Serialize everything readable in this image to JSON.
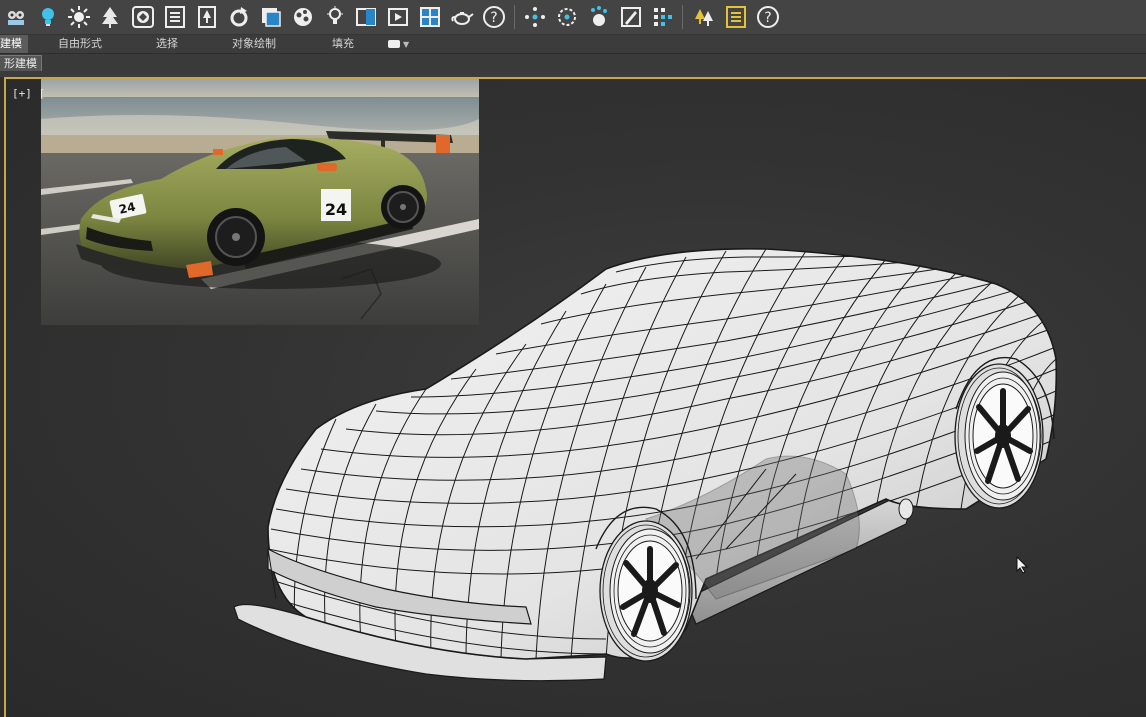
{
  "toolbar": {
    "groups": [
      [
        "render-setup-icon",
        "light-bulb-icon",
        "sun-icon",
        "tree-icon",
        "material-editor-icon",
        "list-icon",
        "figure-icon",
        "rotate-icon",
        "render-frame-icon",
        "shader-ball-icon",
        "bulb-small-icon",
        "render-region-icon",
        "render-view-icon",
        "viewport-icon",
        "teapot-icon",
        "help-icon"
      ],
      [
        "scatter-icon",
        "target-icon",
        "particles-icon",
        "paint-icon",
        "grid-select-icon"
      ],
      [
        "forest-icon",
        "layer-list-icon",
        "help-icon-2"
      ]
    ]
  },
  "ribbon": {
    "tabs": [
      "建模",
      "自由形式",
      "选择",
      "对象绘制",
      "填充"
    ],
    "active_index": 0,
    "extra_menu_icon": "display-dropdown-icon"
  },
  "subbar": {
    "label": "形建模"
  },
  "viewport": {
    "label": "[+] [",
    "reference_image": {
      "subject": "green race car with orange accents on a parking lot by the sea",
      "race_number": "24"
    },
    "colors": {
      "border_active": "#c8a64a",
      "car_body": "#7e8a3e",
      "accent": "#e0682a",
      "wire": "#1a1a1a",
      "surface": "#e9e9e9"
    }
  }
}
